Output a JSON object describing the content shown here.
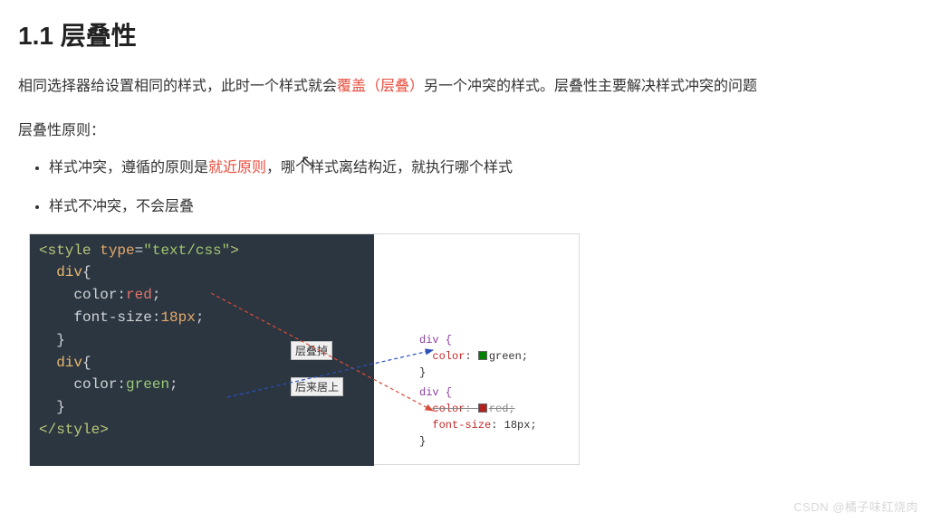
{
  "heading": "1.1 层叠性",
  "paragraph": {
    "pre": "相同选择器给设置相同的样式，此时一个样式就会",
    "highlight": "覆盖（层叠）",
    "post": "另一个冲突的样式。层叠性主要解决样式冲突的问题"
  },
  "principle_label": "层叠性原则：",
  "rules": [
    {
      "pre": "样式冲突，遵循的原则是",
      "highlight": "就近原则",
      "post": "，哪个样式离结构近，就执行哪个样式"
    },
    {
      "pre": "样式不冲突，不会层叠",
      "highlight": "",
      "post": ""
    }
  ],
  "code": {
    "style_open_tag": "<style",
    "style_attr_name": " type",
    "style_attr_eq": "=",
    "style_attr_val": "\"text/css\"",
    "tag_close": ">",
    "sel_div": "div",
    "brace_open": "{",
    "brace_close": "}",
    "prop_color": "color",
    "val_red": "red",
    "prop_font_size": "font-size",
    "val_18px": "18px",
    "val_green": "green",
    "semicolon": ";",
    "colon": ":",
    "style_close": "</style>"
  },
  "annotations": {
    "overridden": "层叠掉",
    "latest_wins": "后来居上"
  },
  "devtools": {
    "rule1": {
      "selector": "div {",
      "prop": "color",
      "value": "green",
      "close": "}"
    },
    "rule2": {
      "selector": "div {",
      "prop_color": "color",
      "val_color": "red",
      "prop_fs": "font-size",
      "val_fs": "18px",
      "close": "}"
    }
  },
  "watermark": "CSDN @橘子味红烧肉"
}
